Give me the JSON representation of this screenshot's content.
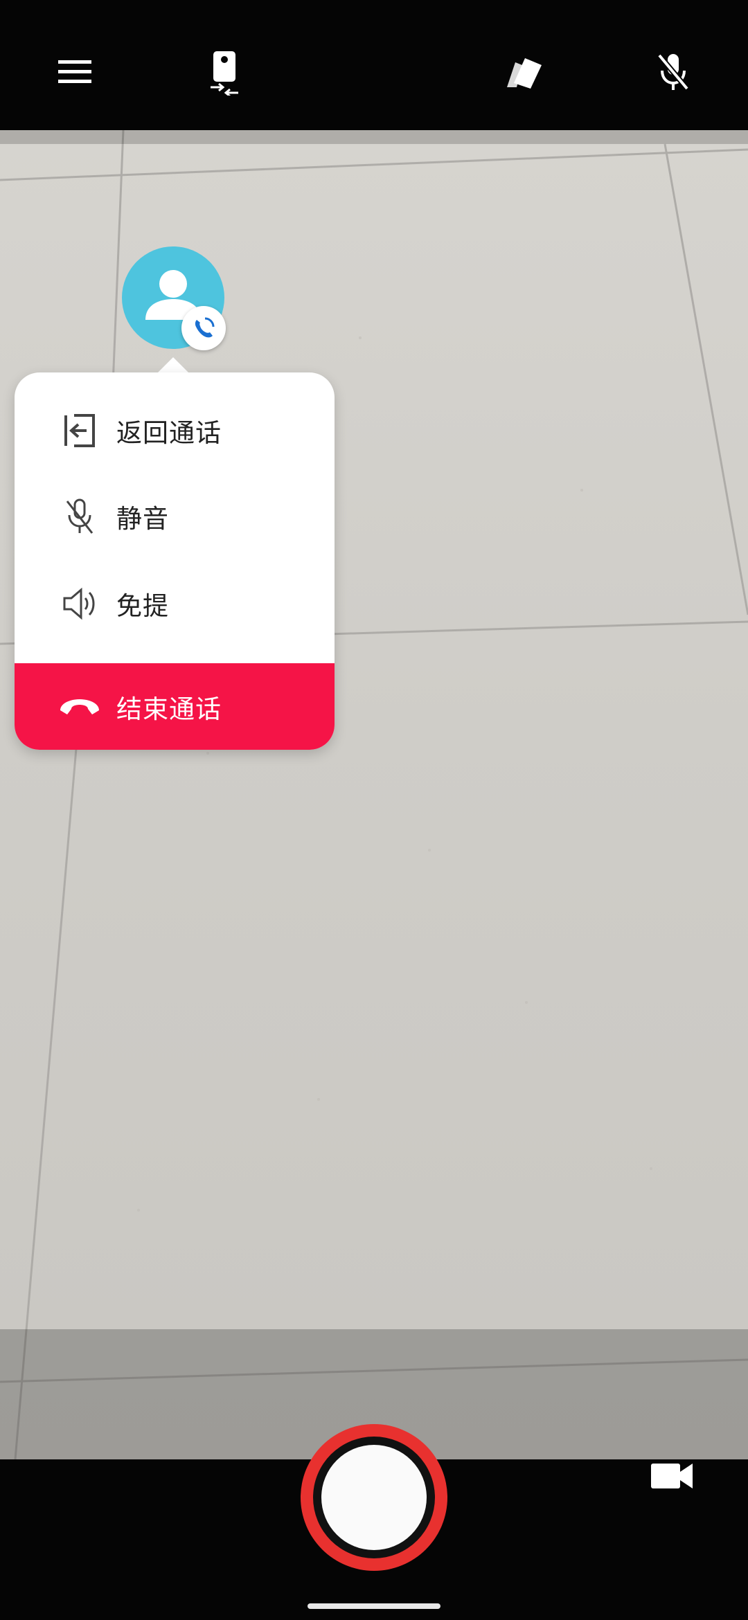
{
  "topbar": {
    "icons": [
      "menu-icon",
      "camera-flip-icon",
      "filter-cards-icon",
      "mic-off-icon"
    ]
  },
  "call_menu": {
    "items": [
      {
        "label": "返回通话",
        "icon": "return-to-call-icon"
      },
      {
        "label": "静音",
        "icon": "mute-icon"
      },
      {
        "label": "免提",
        "icon": "speaker-icon"
      }
    ],
    "end_call": {
      "label": "结束通话",
      "icon": "end-call-icon",
      "color": "#f51447"
    }
  },
  "bubble": {
    "icon": "contact-avatar-icon",
    "badge_icon": "ongoing-call-icon",
    "color": "#4ec4de"
  },
  "bottombar": {
    "shutter_color": "#e8312f",
    "video_icon": "video-camera-icon"
  }
}
